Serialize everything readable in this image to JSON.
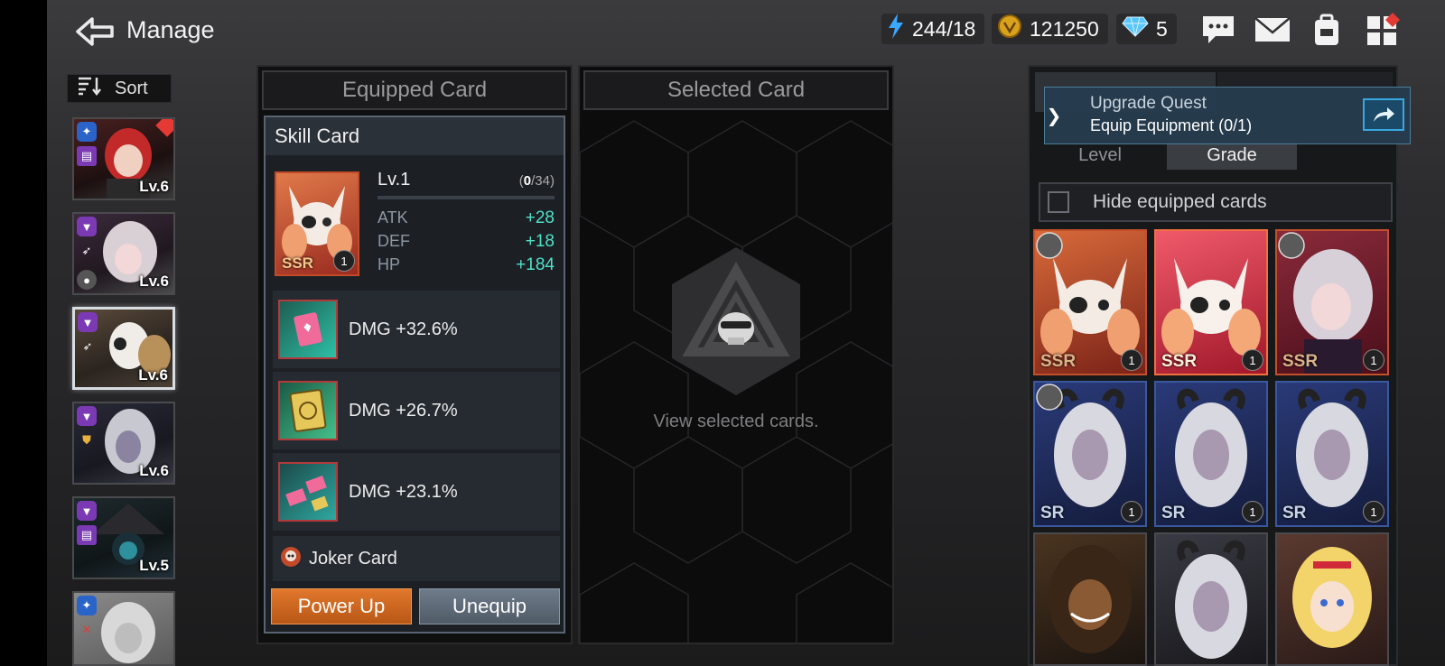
{
  "header": {
    "title": "Manage",
    "energy": "244/18",
    "gold": "121250",
    "gems": "5"
  },
  "sort": {
    "label": "Sort"
  },
  "characters": [
    {
      "level": "Lv.6"
    },
    {
      "level": "Lv.6"
    },
    {
      "level": "Lv.6"
    },
    {
      "level": "Lv.6"
    },
    {
      "level": "Lv.5"
    },
    {
      "level": ""
    }
  ],
  "equipped": {
    "header": "Equipped Card",
    "card_title": "Skill Card",
    "rarity": "SSR",
    "count": "1",
    "level": "Lv.1",
    "progress_current": "0",
    "progress_total": "/34",
    "stats": [
      {
        "name": "ATK",
        "value": "+28"
      },
      {
        "name": "DEF",
        "value": "+18"
      },
      {
        "name": "HP",
        "value": "+184"
      }
    ],
    "effects": [
      {
        "text": "DMG +32.6%"
      },
      {
        "text": "DMG +26.7%"
      },
      {
        "text": "DMG +23.1%"
      }
    ],
    "joker": "Joker Card",
    "power_up": "Power Up",
    "unequip": "Unequip"
  },
  "selected": {
    "header": "Selected Card",
    "empty_text": "View selected cards."
  },
  "right": {
    "tab_level": "Level",
    "tab_grade": "Grade",
    "hide_label": "Hide equipped cards",
    "quest_title": "Upgrade Quest",
    "quest_desc": "Equip Equipment (0/1)",
    "cards": [
      {
        "rarity": "SSR",
        "count": "1"
      },
      {
        "rarity": "SSR",
        "count": "1"
      },
      {
        "rarity": "SSR",
        "count": "1"
      },
      {
        "rarity": "SR",
        "count": "1"
      },
      {
        "rarity": "SR",
        "count": "1"
      },
      {
        "rarity": "SR",
        "count": "1"
      },
      {
        "rarity": "",
        "count": ""
      },
      {
        "rarity": "",
        "count": ""
      },
      {
        "rarity": "",
        "count": ""
      }
    ]
  },
  "colors": {
    "accent_orange": "#d06a22",
    "stat_green": "#4fe0c8",
    "quest_blue": "#4a7d9a"
  }
}
